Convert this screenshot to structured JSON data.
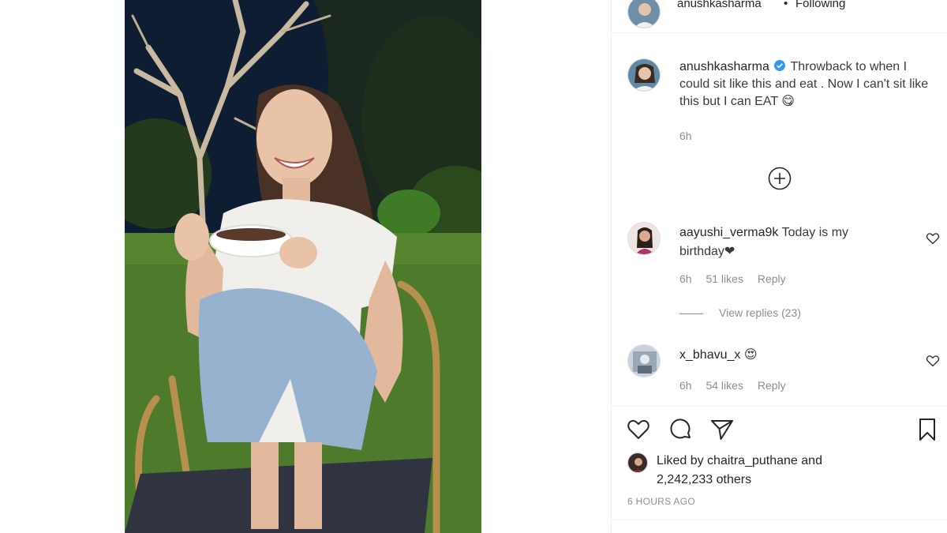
{
  "header": {
    "username": "anushkasharma",
    "separator": "•",
    "follow_status": "Following",
    "more_icon": "more-horizontal-icon"
  },
  "caption": {
    "username": "anushkasharma",
    "verified": true,
    "text": "Throwback to when I could sit like this and eat . Now I can't sit like this but I can EAT 😋",
    "time": "6h"
  },
  "load_more_icon": "plus-circle-icon",
  "comments": [
    {
      "username": "aayushi_verma9k",
      "text": "Today is my birthday❤",
      "time": "6h",
      "likes": "51 likes",
      "reply_label": "Reply",
      "view_replies": "View replies (23)"
    },
    {
      "username": "x_bhavu_x",
      "text": "😍",
      "time": "6h",
      "likes": "54 likes",
      "reply_label": "Reply"
    }
  ],
  "actions": {
    "like_icon": "heart-icon",
    "comment_icon": "comment-icon",
    "share_icon": "send-icon",
    "save_icon": "bookmark-icon"
  },
  "liked_by": {
    "prefix": "Liked by",
    "user": "chaitra_puthane",
    "conj": "and",
    "count": "2,242,233 others"
  },
  "time_ago": "6 HOURS AGO",
  "colors": {
    "verified": "#3897f0",
    "secondary_text": "#8e8e8e",
    "primary_text": "#262626"
  }
}
